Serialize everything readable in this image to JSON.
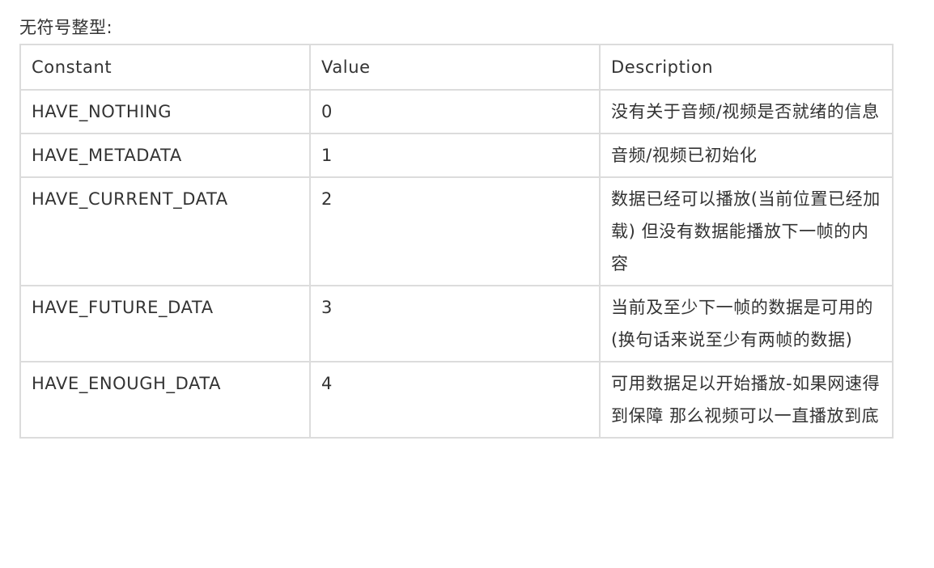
{
  "caption": "无符号整型:",
  "table": {
    "headers": [
      "Constant",
      "Value",
      "Description"
    ],
    "rows": [
      {
        "constant": "HAVE_NOTHING",
        "value": "0",
        "description": "没有关于音频/视频是否就绪的信息"
      },
      {
        "constant": "HAVE_METADATA",
        "value": "1",
        "description": "音频/视频已初始化"
      },
      {
        "constant": "HAVE_CURRENT_DATA",
        "value": "2",
        "description": "数据已经可以播放(当前位置已经加载) 但没有数据能播放下一帧的内容"
      },
      {
        "constant": "HAVE_FUTURE_DATA",
        "value": "3",
        "description": "当前及至少下一帧的数据是可用的(换句话来说至少有两帧的数据)"
      },
      {
        "constant": "HAVE_ENOUGH_DATA",
        "value": "4",
        "description": "可用数据足以开始播放-如果网速得到保障 那么视频可以一直播放到底"
      }
    ]
  }
}
